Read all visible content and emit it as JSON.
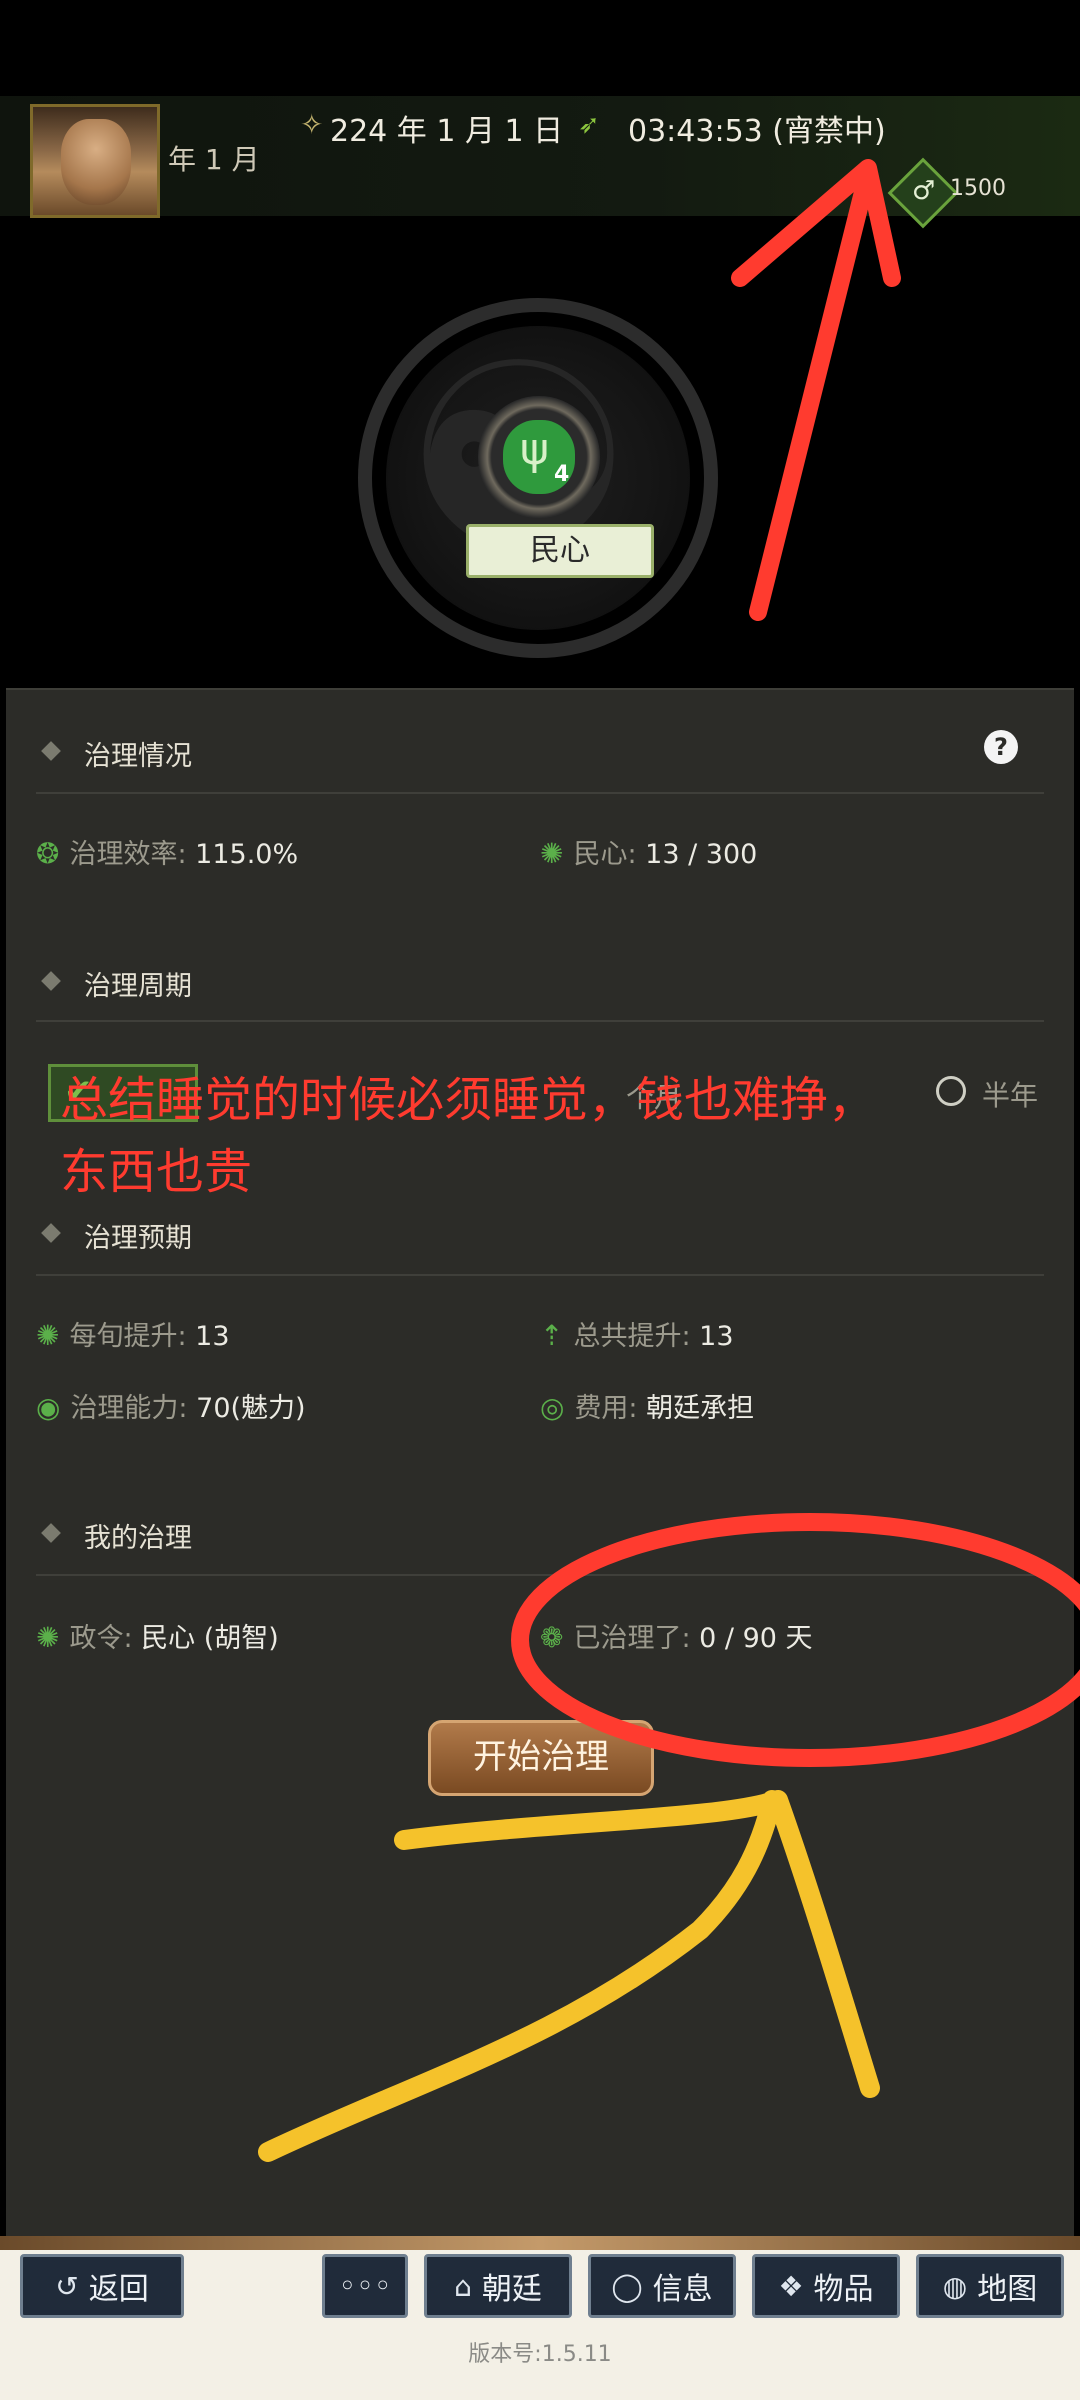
{
  "header": {
    "year_fragment": "年 1 月",
    "date": "224 年 1 月 1 日",
    "time": "03:43:53 (宵禁中)",
    "money": "1500"
  },
  "badge": {
    "level": "4",
    "label": "民心"
  },
  "sections": {
    "status_title": "治理情况",
    "status_rows": {
      "efficiency_label": "治理效率:",
      "efficiency_value": "115.0%",
      "mind_label": "民心:",
      "mind_value": "13 / 300"
    },
    "cycle_title": "治理周期",
    "cycle_options": {
      "month": "个月",
      "half_year": "半年"
    },
    "expect_title": "治理预期",
    "expect_rows": {
      "per_label": "每旬提升:",
      "per_value": "13",
      "total_label": "总共提升:",
      "total_value": "13",
      "ability_label": "治理能力:",
      "ability_value": "70(魅力)",
      "cost_label": "费用:",
      "cost_value": "朝廷承担"
    },
    "mine_title": "我的治理",
    "mine_rows": {
      "order_label": "政令:",
      "order_value": "民心 (胡智)",
      "done_label": "已治理了:",
      "done_value": "0 / 90 天"
    }
  },
  "annotation": {
    "line1": "总结睡觉的时候必须睡觉，钱也难挣，",
    "line2": "东西也贵"
  },
  "start_button": "开始治理",
  "nav": {
    "back": "返回",
    "more": "◦◦◦",
    "court": "朝廷",
    "info": "信息",
    "items": "物品",
    "map": "地图"
  },
  "version": "版本号:1.5.11",
  "colors": {
    "annotation_red": "#ff3b2f",
    "annotation_yellow": "#f5c22b"
  }
}
